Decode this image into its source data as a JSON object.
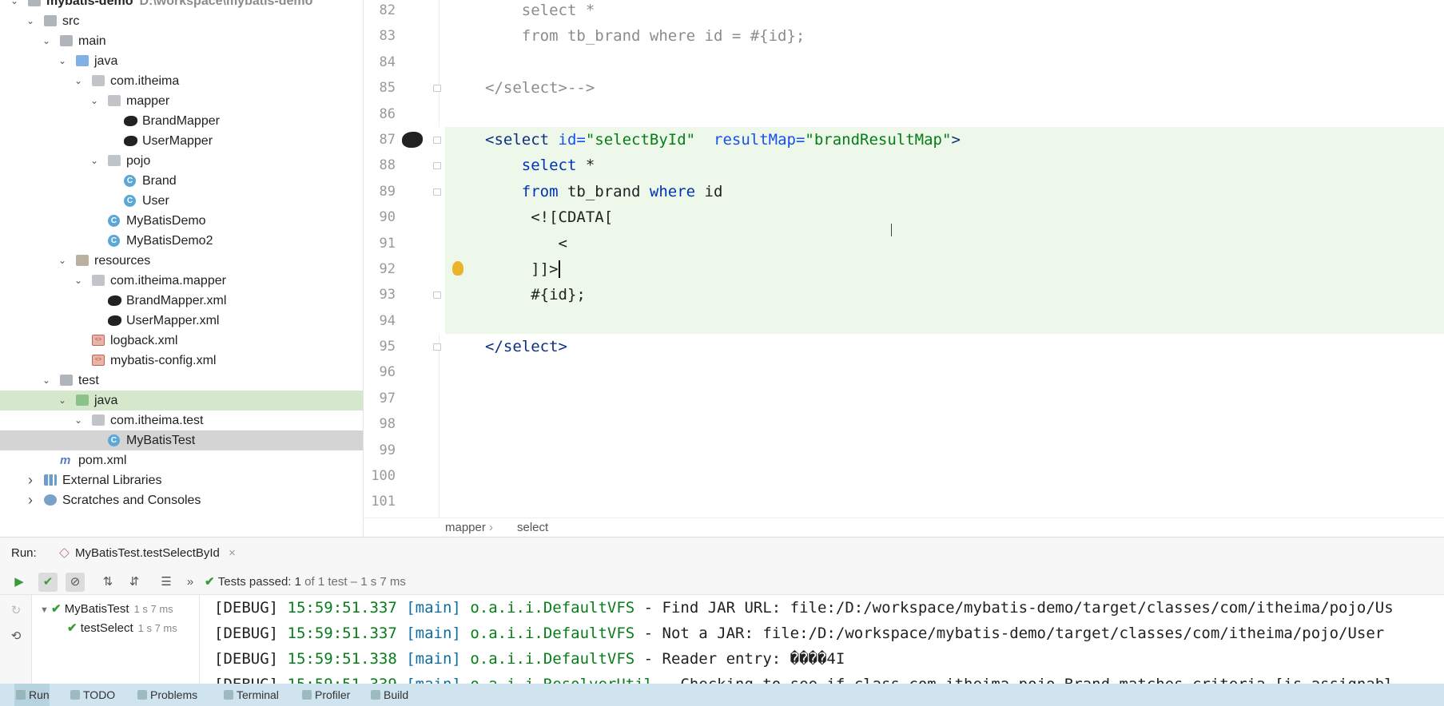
{
  "project_tree": {
    "rows": [
      {
        "label": "mybatis-demo",
        "path": "D:\\workspace\\mybatis-demo",
        "icon": "module-folder-icon",
        "arrow": "expanded",
        "indent": 0,
        "bold": true
      },
      {
        "label": "src",
        "icon": "folder-icon",
        "arrow": "expanded",
        "indent": 1
      },
      {
        "label": "main",
        "icon": "folder-icon",
        "arrow": "expanded",
        "indent": 2
      },
      {
        "label": "java",
        "icon": "source-folder-icon",
        "arrow": "expanded",
        "indent": 3
      },
      {
        "label": "com.itheima",
        "icon": "package-icon",
        "arrow": "expanded",
        "indent": 4
      },
      {
        "label": "mapper",
        "icon": "package-icon",
        "arrow": "expanded",
        "indent": 5
      },
      {
        "label": "BrandMapper",
        "icon": "mybatis-bird-icon",
        "arrow": "none",
        "indent": 6
      },
      {
        "label": "UserMapper",
        "icon": "mybatis-bird-icon",
        "arrow": "none",
        "indent": 6
      },
      {
        "label": "pojo",
        "icon": "package-icon",
        "arrow": "expanded",
        "indent": 5
      },
      {
        "label": "Brand",
        "icon": "class-icon",
        "arrow": "none",
        "indent": 6
      },
      {
        "label": "User",
        "icon": "class-icon",
        "arrow": "none",
        "indent": 6
      },
      {
        "label": "MyBatisDemo",
        "icon": "class-icon",
        "arrow": "none",
        "indent": 5
      },
      {
        "label": "MyBatisDemo2",
        "icon": "class-icon",
        "arrow": "none",
        "indent": 5
      },
      {
        "label": "resources",
        "icon": "resources-folder-icon",
        "arrow": "expanded",
        "indent": 3
      },
      {
        "label": "com.itheima.mapper",
        "icon": "package-icon",
        "arrow": "expanded",
        "indent": 4
      },
      {
        "label": "BrandMapper.xml",
        "icon": "mybatis-bird-icon",
        "arrow": "none",
        "indent": 5
      },
      {
        "label": "UserMapper.xml",
        "icon": "mybatis-bird-icon",
        "arrow": "none",
        "indent": 5
      },
      {
        "label": "logback.xml",
        "icon": "xml-file-icon",
        "arrow": "none",
        "indent": 4
      },
      {
        "label": "mybatis-config.xml",
        "icon": "xml-file-icon",
        "arrow": "none",
        "indent": 4
      },
      {
        "label": "test",
        "icon": "folder-icon",
        "arrow": "expanded",
        "indent": 2
      },
      {
        "label": "java",
        "icon": "test-folder-icon",
        "arrow": "expanded",
        "indent": 3,
        "highlight": true
      },
      {
        "label": "com.itheima.test",
        "icon": "package-icon",
        "arrow": "expanded",
        "indent": 4
      },
      {
        "label": "MyBatisTest",
        "icon": "class-icon",
        "arrow": "none",
        "indent": 5,
        "selected": true
      },
      {
        "label": "pom.xml",
        "icon": "maven-icon",
        "arrow": "none",
        "indent": 2
      },
      {
        "label": "External Libraries",
        "icon": "libraries-icon",
        "arrow": "collapsed",
        "indent": 1
      },
      {
        "label": "Scratches and Consoles",
        "icon": "scratches-icon",
        "arrow": "collapsed",
        "indent": 1
      }
    ]
  },
  "editor": {
    "lines": [
      {
        "n": "82",
        "segs": [
          [
            "cmt",
            "    select *"
          ]
        ]
      },
      {
        "n": "83",
        "segs": [
          [
            "cmt",
            "    from tb_brand where id = #{id};"
          ]
        ]
      },
      {
        "n": "84",
        "segs": []
      },
      {
        "n": "85",
        "fold": true,
        "segs": [
          [
            "cmt",
            "</select>-->"
          ]
        ]
      },
      {
        "n": "86",
        "segs": []
      },
      {
        "n": "87",
        "fold": true,
        "bird": true,
        "green": true,
        "segs": [
          [
            "tag",
            "<select "
          ],
          [
            "attr",
            "id="
          ],
          [
            "str",
            "\"selectById\""
          ],
          [
            "plain",
            "  "
          ],
          [
            "attr",
            "resultMap="
          ],
          [
            "str",
            "\"brandResultMap\""
          ],
          [
            "tag",
            ">"
          ]
        ]
      },
      {
        "n": "88",
        "fold": true,
        "green": true,
        "segs": [
          [
            "kw",
            "    select "
          ],
          [
            "plain",
            "*"
          ]
        ]
      },
      {
        "n": "89",
        "fold": true,
        "green": true,
        "segs": [
          [
            "kw",
            "    from "
          ],
          [
            "plain",
            "tb_brand "
          ],
          [
            "kw",
            "where "
          ],
          [
            "plain",
            "id"
          ]
        ]
      },
      {
        "n": "90",
        "green": true,
        "segs": [
          [
            "plain",
            "     <![CDATA["
          ]
        ]
      },
      {
        "n": "91",
        "green": true,
        "segs": [
          [
            "plain",
            "        <"
          ]
        ]
      },
      {
        "n": "92",
        "green": true,
        "bulb": true,
        "cursor": true,
        "segs": [
          [
            "plain",
            "     ]]>"
          ]
        ]
      },
      {
        "n": "93",
        "fold": true,
        "green": true,
        "segs": [
          [
            "plain",
            "     #{id};"
          ]
        ]
      },
      {
        "n": "94",
        "green": true,
        "segs": []
      },
      {
        "n": "95",
        "fold": true,
        "segs": [
          [
            "tag",
            "</select>"
          ]
        ]
      },
      {
        "n": "96",
        "segs": []
      },
      {
        "n": "97",
        "segs": []
      },
      {
        "n": "98",
        "segs": []
      },
      {
        "n": "99",
        "segs": []
      },
      {
        "n": "100",
        "segs": []
      },
      {
        "n": "101",
        "segs": []
      }
    ]
  },
  "breadcrumb": {
    "items": [
      "mapper",
      "select"
    ],
    "separator": "›"
  },
  "run_panel": {
    "label": "Run:",
    "tab_title": "MyBatisTest.testSelectById",
    "close": "×",
    "status_main": "Tests passed: ",
    "status_count": "1",
    "status_rest": " of 1 test – 1 s 7 ms",
    "tree": [
      {
        "label": "MyBatisTest",
        "time": "1 s 7 ms"
      },
      {
        "label": "testSelect",
        "time": "1 s 7 ms"
      }
    ],
    "console": [
      {
        "level": "[DEBUG]",
        "time": "15:59:51.337",
        "thread": "[main]",
        "logger": "o.a.i.i.DefaultVFS",
        "msg": " - Find JAR URL: file:/D:/workspace/mybatis-demo/target/classes/com/itheima/pojo/Us"
      },
      {
        "level": "[DEBUG]",
        "time": "15:59:51.337",
        "thread": "[main]",
        "logger": "o.a.i.i.DefaultVFS",
        "msg": " - Not a JAR: file:/D:/workspace/mybatis-demo/target/classes/com/itheima/pojo/User"
      },
      {
        "level": "[DEBUG]",
        "time": "15:59:51.338",
        "thread": "[main]",
        "logger": "o.a.i.i.DefaultVFS",
        "msg": " - Reader entry: ����4I"
      },
      {
        "level": "[DEBUG]",
        "time": "15:59:51.339",
        "thread": "[main]",
        "logger": "o.a.i.i.ResolverUtil",
        "msg": " - Checking to see if class com.itheima.pojo.Brand matches criteria [is assignabl"
      }
    ]
  },
  "bottom_toolbar": {
    "items": [
      {
        "label": "Run",
        "icon": "run-icon",
        "active": true
      },
      {
        "label": "TODO",
        "icon": "todo-icon"
      },
      {
        "label": "Problems",
        "icon": "problems-icon"
      },
      {
        "label": "Terminal",
        "icon": "terminal-icon"
      },
      {
        "label": "Profiler",
        "icon": "profiler-icon"
      },
      {
        "label": "Build",
        "icon": "build-icon"
      }
    ]
  },
  "colors": {
    "accent_green": "#edf8ea",
    "selection": "#d4d4d4",
    "tag": "#0d2f80",
    "string": "#067d17",
    "keyword": "#0033b3"
  }
}
